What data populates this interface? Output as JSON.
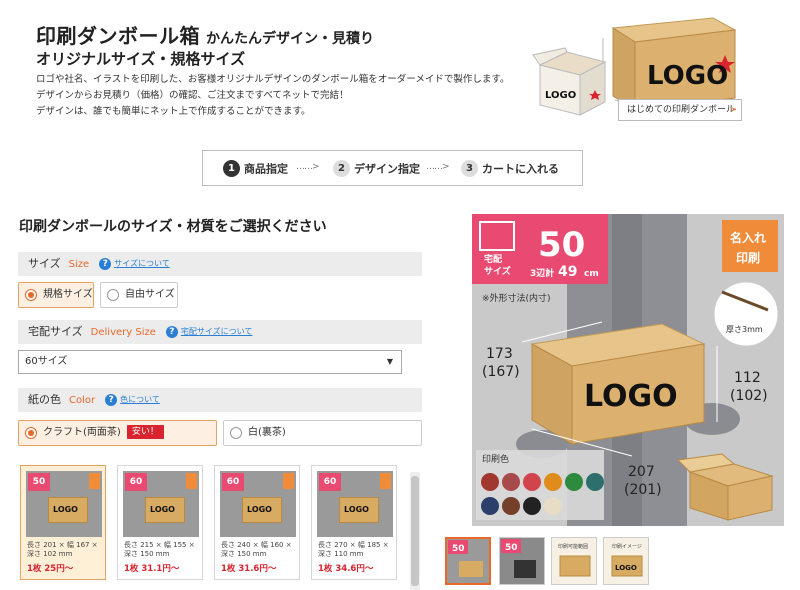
{
  "header": {
    "title": "印刷ダンボール箱",
    "title_sub": "かんたんデザイン・見積り",
    "subtitle": "オリジナルサイズ・規格サイズ",
    "desc": [
      "ロゴや社名、イラストを印刷した、お客様オリジナルデザインのダンボール箱をオーダーメイドで製作します。",
      "デザインからお見積り（価格）の確認、ご注文まですべてネットで完結！",
      "デザインは、誰でも簡単にネット上で作成することができます。"
    ],
    "intro_link": "はじめての印刷ダンボール",
    "art_logo_big": "LOGO",
    "art_logo_small": "LOGO"
  },
  "steps": [
    {
      "num": "1",
      "label": "商品指定",
      "active": true
    },
    {
      "num": "2",
      "label": "デザイン指定",
      "active": false
    },
    {
      "num": "3",
      "label": "カートに入れる",
      "active": false
    }
  ],
  "step_separator": "……>",
  "left": {
    "section_title": "印刷ダンボールのサイズ・材質をご選択ください",
    "size": {
      "label": "サイズ",
      "en": "Size",
      "help": "サイズについて",
      "options": [
        "規格サイズ",
        "自由サイズ"
      ],
      "selected": "規格サイズ"
    },
    "delivery": {
      "label": "宅配サイズ",
      "en": "Delivery Size",
      "help": "宅配サイズについて",
      "value": "60サイズ"
    },
    "color": {
      "label": "紙の色",
      "en": "Color",
      "help": "色について",
      "options": [
        "クラフト(両面茶)",
        "白(裏茶)"
      ],
      "selected": "クラフト(両面茶)",
      "badge": "安い！"
    },
    "products": [
      {
        "size_num": "50",
        "dims": [
          "長さ 201 × 幅 167 ×",
          "深さ 102 mm"
        ],
        "price": "1枚 25円〜",
        "selected": true
      },
      {
        "size_num": "60",
        "dims": [
          "長さ 215 × 幅 155 ×",
          "深さ 150 mm"
        ],
        "price": "1枚 31.1円〜",
        "selected": false
      },
      {
        "size_num": "60",
        "dims": [
          "長さ 240 × 幅 160 ×",
          "深さ 150 mm"
        ],
        "price": "1枚 31.6円〜",
        "selected": false
      },
      {
        "size_num": "60",
        "dims": [
          "長さ 270 × 幅 185 ×",
          "深さ 110 mm"
        ],
        "price": "1枚 34.6円〜",
        "selected": false
      }
    ]
  },
  "preview": {
    "delivery_label": [
      "宅配",
      "サイズ"
    ],
    "size_num": "50",
    "three_side_label": "3辺計",
    "three_side_value": "49",
    "three_side_unit": "cm",
    "name_print": [
      "名入れ",
      "印刷"
    ],
    "outer_inner_note": "※外形寸法(内寸)",
    "thickness": "厚さ3mm",
    "logo": "LOGO",
    "dim_depth": [
      "173",
      "(167)"
    ],
    "dim_height": [
      "112",
      "(102)"
    ],
    "dim_width": [
      "207",
      "(201)"
    ],
    "print_color_label": "印刷色",
    "swatches": [
      "#a2372f",
      "#a8494c",
      "#d1444b",
      "#e08c1c",
      "#2e8a3e",
      "#2c6f6c",
      "#2c3f6b",
      "#74402a",
      "#222222",
      "#e6ddc4"
    ]
  },
  "thumbnails": [
    {
      "type": "size",
      "num": "50",
      "selected": true
    },
    {
      "type": "size",
      "num": "50",
      "selected": false
    },
    {
      "type": "example",
      "caption": "印刷可能範囲",
      "selected": false
    },
    {
      "type": "example",
      "caption": "印刷イメージ",
      "selected": false
    }
  ]
}
